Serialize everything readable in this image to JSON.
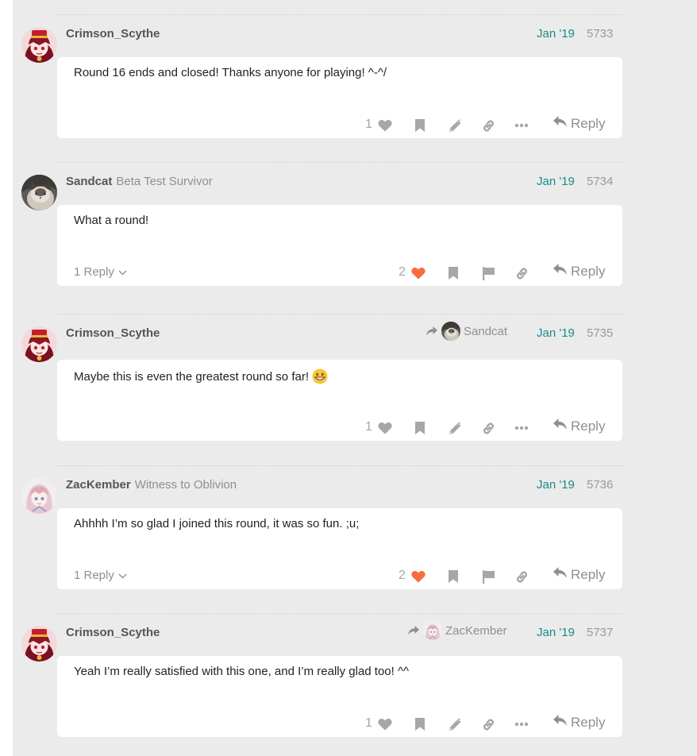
{
  "colors": {
    "page_bg": "#ebebeb",
    "card_bg": "#ffffff",
    "date_link": "#1a8a8a",
    "like_active": "#fa6c3d",
    "muted": "#8f8f8f",
    "icon": "#a7a7a7"
  },
  "reply_label": "Reply",
  "posts": [
    {
      "username": "Crimson_Scythe",
      "user_title": "",
      "reply_to": "",
      "date": "Jan '19",
      "post_number": "5733",
      "body": "Round 16 ends and closed! Thanks anyone for playing! ^-^/",
      "has_emoji": false,
      "replies_count": "",
      "likes": "1",
      "liked": false,
      "own_post": true,
      "avatar_icon": "anime-girl-red-hat-avatar"
    },
    {
      "username": "Sandcat",
      "user_title": "Beta Test Survivor",
      "reply_to": "",
      "date": "Jan '19",
      "post_number": "5734",
      "body": "What a round!",
      "has_emoji": false,
      "replies_count": "1 Reply",
      "likes": "2",
      "liked": true,
      "own_post": false,
      "avatar_icon": "cat-photo-avatar"
    },
    {
      "username": "Crimson_Scythe",
      "user_title": "",
      "reply_to": "Sandcat",
      "date": "Jan '19",
      "post_number": "5735",
      "body": "Maybe this is even the greatest round so far!",
      "has_emoji": true,
      "emoji_icon": "grinning-face-emoji",
      "replies_count": "",
      "likes": "1",
      "liked": false,
      "own_post": true,
      "avatar_icon": "anime-girl-red-hat-avatar"
    },
    {
      "username": "ZacKember",
      "user_title": "Witness to Oblivion",
      "reply_to": "",
      "date": "Jan '19",
      "post_number": "5736",
      "body": "Ahhhh I’m so glad I joined this round, it was so fun. ;u;",
      "has_emoji": false,
      "replies_count": "1 Reply",
      "likes": "2",
      "liked": true,
      "own_post": false,
      "avatar_icon": "anime-pink-hair-avatar"
    },
    {
      "username": "Crimson_Scythe",
      "user_title": "",
      "reply_to": "ZacKember",
      "date": "Jan '19",
      "post_number": "5737",
      "body": "Yeah I’m really satisfied with this one, and I’m really glad too! ^^",
      "has_emoji": false,
      "replies_count": "",
      "likes": "1",
      "liked": false,
      "own_post": true,
      "avatar_icon": "anime-girl-red-hat-avatar"
    }
  ]
}
